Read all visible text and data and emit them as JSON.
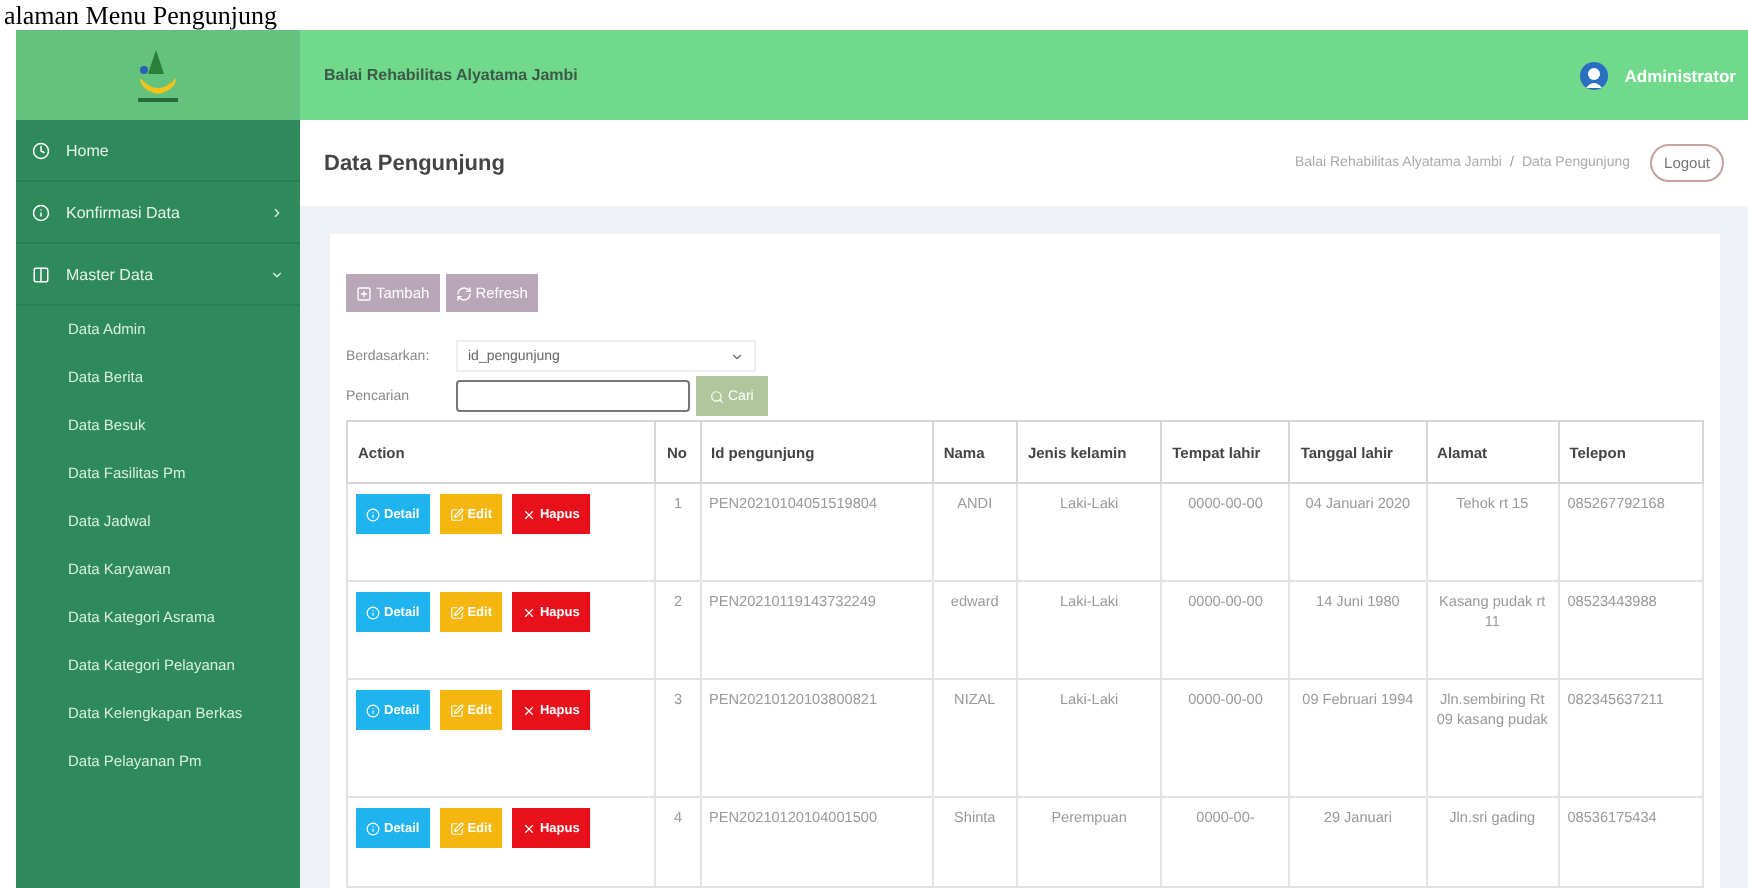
{
  "caption": "alaman Menu Pengunjung",
  "header": {
    "site_title": "Balai Rehabilitas Alyatama Jambi",
    "user": "Administrator"
  },
  "sidebar": {
    "items": [
      {
        "label": "Home"
      },
      {
        "label": "Konfirmasi Data",
        "expanded": false
      },
      {
        "label": "Master Data",
        "expanded": true,
        "children": [
          {
            "label": "Data Admin"
          },
          {
            "label": "Data Berita"
          },
          {
            "label": "Data Besuk"
          },
          {
            "label": "Data Fasilitas Pm"
          },
          {
            "label": "Data Jadwal"
          },
          {
            "label": "Data Karyawan"
          },
          {
            "label": "Data Kategori Asrama"
          },
          {
            "label": "Data Kategori Pelayanan"
          },
          {
            "label": "Data Kelengkapan Berkas"
          },
          {
            "label": "Data Pelayanan Pm"
          }
        ]
      }
    ]
  },
  "page": {
    "title": "Data Pengunjung",
    "breadcrumb": [
      "Balai Rehabilitas Alyatama Jambi",
      "Data Pengunjung"
    ],
    "breadcrumb_separator": "/",
    "logout": "Logout"
  },
  "toolbar": {
    "buttons": [
      {
        "label": "Tambah"
      },
      {
        "label": "Refresh"
      }
    ]
  },
  "filter": {
    "by_label": "Berdasarkan:",
    "by_value": "id_pengunjung",
    "search_label": "Pencarian",
    "search_button": "Cari"
  },
  "table": {
    "columns": [
      "Action",
      "No",
      "Id pengunjung",
      "Nama",
      "Jenis kelamin",
      "Tempat lahir",
      "Tanggal lahir",
      "Alamat",
      "Telepon"
    ],
    "rows": [
      {
        "actions": [
          {
            "label": "Detail",
            "kind": "detail"
          },
          {
            "label": "Edit",
            "kind": "edit"
          },
          {
            "label": "Hapus",
            "kind": "delete"
          }
        ],
        "no": "1",
        "id": "PEN20210104051519804",
        "nama": "ANDI",
        "jenis_kelamin": "Laki-Laki",
        "tempat_lahir": "0000-00-00",
        "tanggal_lahir": "04 Januari 2020",
        "alamat": "Tehok rt 15",
        "telepon": "085267792168"
      },
      {
        "actions": [
          {
            "label": "Detail",
            "kind": "detail"
          },
          {
            "label": "Edit",
            "kind": "edit"
          },
          {
            "label": "Hapus",
            "kind": "delete"
          }
        ],
        "no": "2",
        "id": "PEN20210119143732249",
        "nama": "edward",
        "jenis_kelamin": "Laki-Laki",
        "tempat_lahir": "0000-00-00",
        "tanggal_lahir": "14 Juni 1980",
        "alamat": "Kasang pudak rt 11",
        "telepon": "08523443988"
      },
      {
        "actions": [
          {
            "label": "Detail",
            "kind": "detail"
          },
          {
            "label": "Edit",
            "kind": "edit"
          },
          {
            "label": "Hapus",
            "kind": "delete"
          }
        ],
        "no": "3",
        "id": "PEN20210120103800821",
        "nama": "NIZAL",
        "jenis_kelamin": "Laki-Laki",
        "tempat_lahir": "0000-00-00",
        "tanggal_lahir": "09 Februari 1994",
        "alamat": "Jln.sembiring Rt 09 kasang pudak",
        "telepon": "082345637211"
      },
      {
        "actions": [
          {
            "label": "Detail",
            "kind": "detail"
          },
          {
            "label": "Edit",
            "kind": "edit"
          },
          {
            "label": "Hapus",
            "kind": "delete"
          }
        ],
        "no": "4",
        "id": "PEN20210120104001500",
        "nama": "Shinta",
        "jenis_kelamin": "Perempuan",
        "tempat_lahir": "0000-00-",
        "tanggal_lahir": "29 Januari",
        "alamat": "Jln.sri gading",
        "telepon": "08536175434"
      }
    ]
  }
}
